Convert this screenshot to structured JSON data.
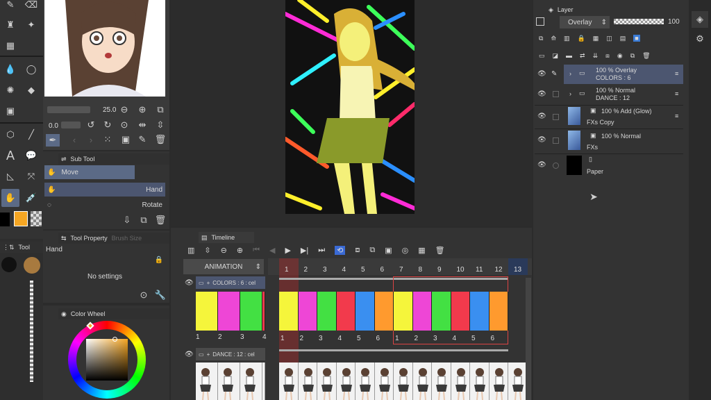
{
  "subtool": {
    "tab": "Sub Tool",
    "items": [
      {
        "label": "Move"
      },
      {
        "label": "Hand"
      },
      {
        "label": "Rotate"
      }
    ]
  },
  "brush": {
    "size": "25.0",
    "opacity": "0.0"
  },
  "tool_property": {
    "tab": "Tool Property",
    "tab2": "Brush Size",
    "tool_name": "Hand",
    "empty": "No settings"
  },
  "color_wheel": {
    "tab": "Color Wheel",
    "main_color": "#f5a623",
    "accent": "#ff9900"
  },
  "left_narrow": {
    "tab": "Tool"
  },
  "layer_panel": {
    "tab": "Layer",
    "blend": "Overlay",
    "opacity": "100",
    "layers": [
      {
        "line1": "100 % Overlay",
        "line2": "COLORS : 6"
      },
      {
        "line1": "100 % Normal",
        "line2": "DANCE : 12"
      },
      {
        "line1": "100 % Add (Glow)",
        "line2": "FXs Copy"
      },
      {
        "line1": "100 % Normal",
        "line2": "FXs"
      },
      {
        "line1": "",
        "line2": "Paper"
      }
    ]
  },
  "timeline": {
    "tab": "Timeline",
    "animation_label": "ANIMATION",
    "frames": [
      "1",
      "2",
      "3",
      "4",
      "5",
      "6",
      "7",
      "8",
      "9",
      "10",
      "11",
      "12",
      "13"
    ],
    "current": "1",
    "tracks": [
      {
        "label": "COLORS : 6 : cel"
      },
      {
        "label": "DANCE : 12 : cel"
      }
    ],
    "pre_cels": [
      "1",
      "2",
      "3",
      "4"
    ],
    "cels": [
      "1",
      "2",
      "3",
      "4",
      "5",
      "6",
      "1",
      "2",
      "3",
      "4",
      "5",
      "6"
    ],
    "cel_colors": [
      "#f5f53b",
      "#ee46d6",
      "#43e043",
      "#f23a4c",
      "#3a8ff0",
      "#ff9a2e",
      "#f5f53b",
      "#ee46d6",
      "#43e043",
      "#f23a4c",
      "#3a8ff0",
      "#ff9a2e"
    ],
    "pre_colors": [
      "#f5f53b",
      "#ee46d6",
      "#43e043",
      "#f23a4c"
    ]
  }
}
